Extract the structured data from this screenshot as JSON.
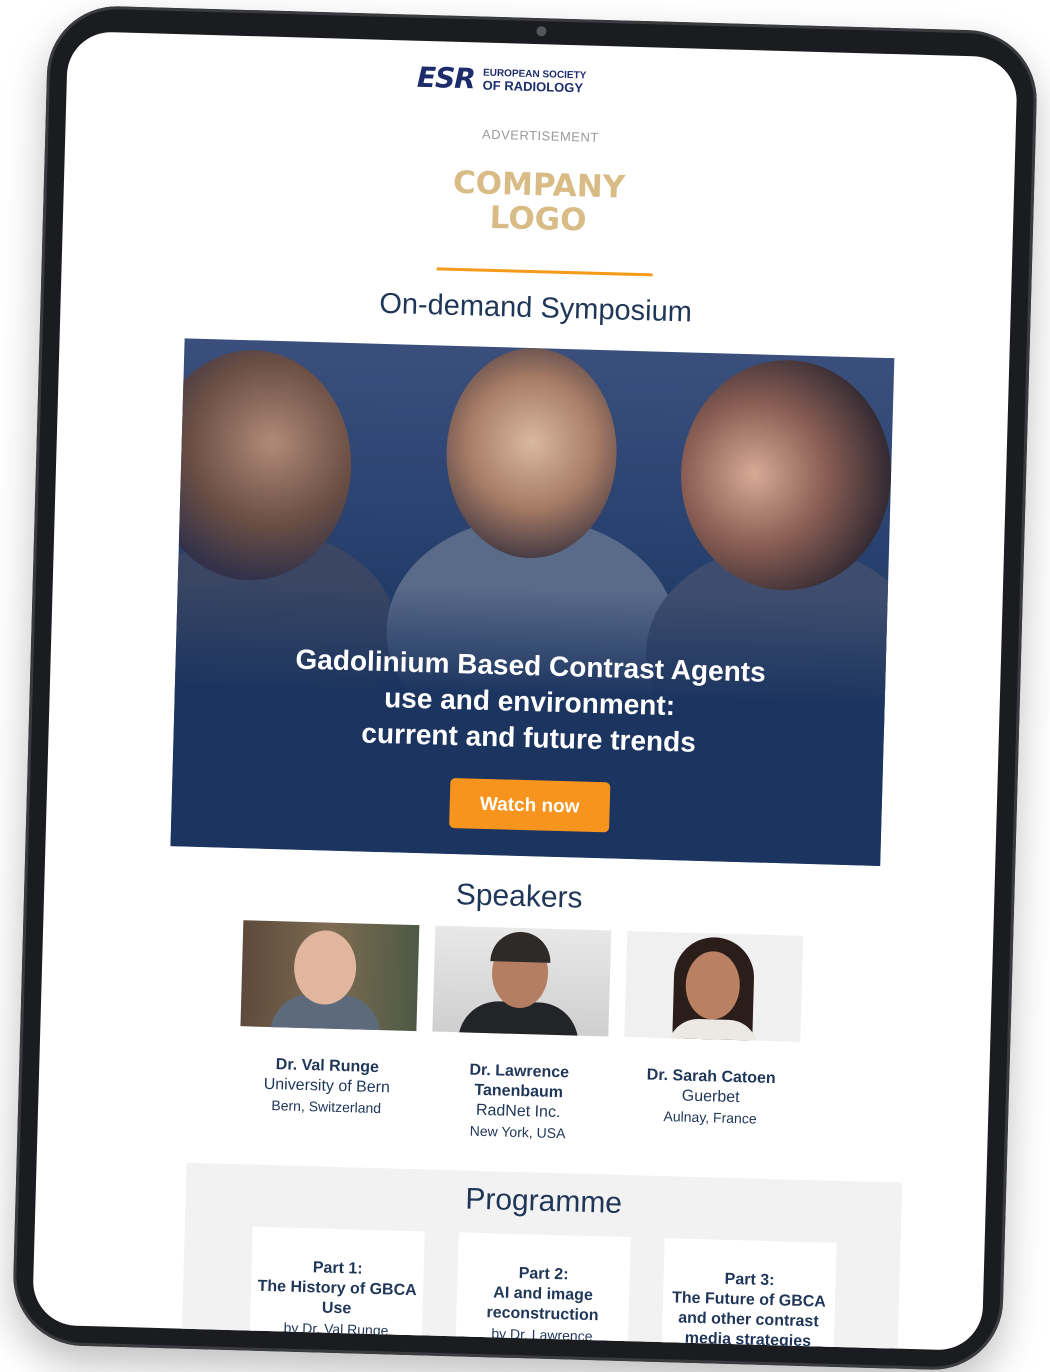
{
  "header": {
    "brand_mark": "ESR",
    "brand_line1": "EUROPEAN SOCIETY",
    "brand_line2": "OF RADIOLOGY",
    "advertisement": "ADVERTISEMENT",
    "company_logo_line1": "COMPANY",
    "company_logo_line2": "LOGO",
    "headline": "On-demand Symposium"
  },
  "hero": {
    "title_line1": "Gadolinium Based Contrast Agents",
    "title_line2": "use and environment:",
    "title_line3": "current and future trends",
    "button_label": "Watch now"
  },
  "speakers": {
    "title": "Speakers",
    "items": [
      {
        "name": "Dr. Val Runge",
        "institution": "University of Bern",
        "location": "Bern, Switzerland"
      },
      {
        "name": "Dr. Lawrence Tanenbaum",
        "institution": "RadNet Inc.",
        "location": "New York, USA"
      },
      {
        "name": "Dr. Sarah Catoen",
        "institution": "Guerbet",
        "location": "Aulnay, France"
      }
    ]
  },
  "programme": {
    "title": "Programme",
    "parts": [
      {
        "label": "Part 1:",
        "title": "The History of GBCA Use",
        "by": "by Dr. Val Runge"
      },
      {
        "label": "Part 2:",
        "title": "AI and image reconstruction",
        "by": "by Dr. Lawrence"
      },
      {
        "label": "Part 3:",
        "title": "The Future of GBCA and other contrast media strategies",
        "by": ""
      }
    ]
  },
  "colors": {
    "accent_orange": "#f7941d",
    "navy": "#1f3658",
    "logo_gold": "#d9bb86"
  }
}
